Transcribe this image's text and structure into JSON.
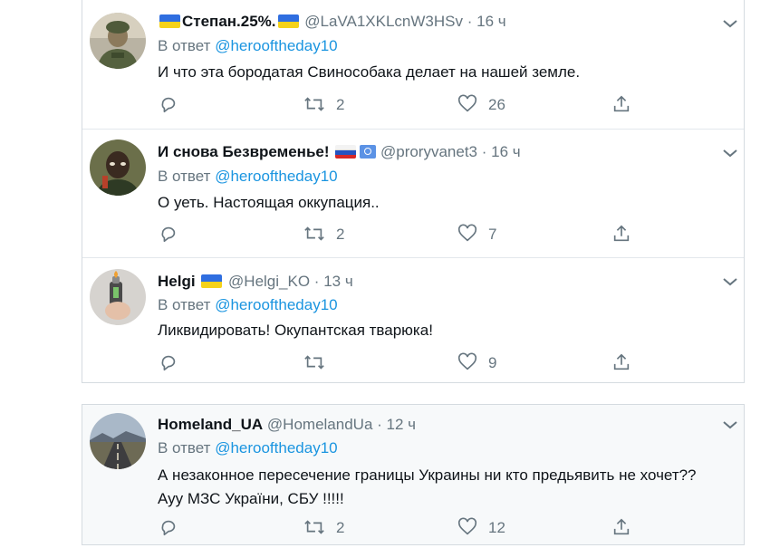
{
  "tweets": [
    {
      "name": "Степан.25%.",
      "flag_before": "ua",
      "flag_after": "ua",
      "handle": "@LaVA1XKLcnW3HSv",
      "dot": "·",
      "time": "16 ч",
      "reply_prefix": "В ответ",
      "reply_to": "@herooftheday10",
      "text": "И что эта бородатая Свинособака делает на нашей земле.",
      "retweets": "2",
      "likes": "26"
    },
    {
      "name": "И снова Безвременье!",
      "flag_after": "ru-un",
      "handle": "@proryvanet3",
      "dot": "·",
      "time": "16 ч",
      "reply_prefix": "В ответ",
      "reply_to": "@herooftheday10",
      "text": "О уеть. Настоящая оккупация..",
      "retweets": "2",
      "likes": "7"
    },
    {
      "name": "Helgi",
      "flag_after": "ua",
      "handle": "@Helgi_KO",
      "dot": "·",
      "time": "13 ч",
      "reply_prefix": "В ответ",
      "reply_to": "@herooftheday10",
      "text": "Ликвидировать! Окупантская тварюка!",
      "retweets": "",
      "likes": "9"
    },
    {
      "name": "Homeland_UA",
      "handle": "@HomelandUa",
      "dot": "·",
      "time": "12 ч",
      "reply_prefix": "В ответ",
      "reply_to": "@herooftheday10",
      "text": "А незаконное пересечение границы Украины ни кто предьявить не хочет?? Ауу МЗС України, СБУ !!!!!",
      "retweets": "2",
      "likes": "12"
    }
  ],
  "icons": {
    "reply": "reply-icon",
    "retweet": "retweet-icon",
    "like": "heart-icon",
    "share": "share-icon",
    "menu": "chevron-down-icon"
  },
  "colors": {
    "mention": "#1b95e0",
    "muted": "#66757f",
    "text": "#0f1419",
    "border": "#d5dbe0"
  }
}
